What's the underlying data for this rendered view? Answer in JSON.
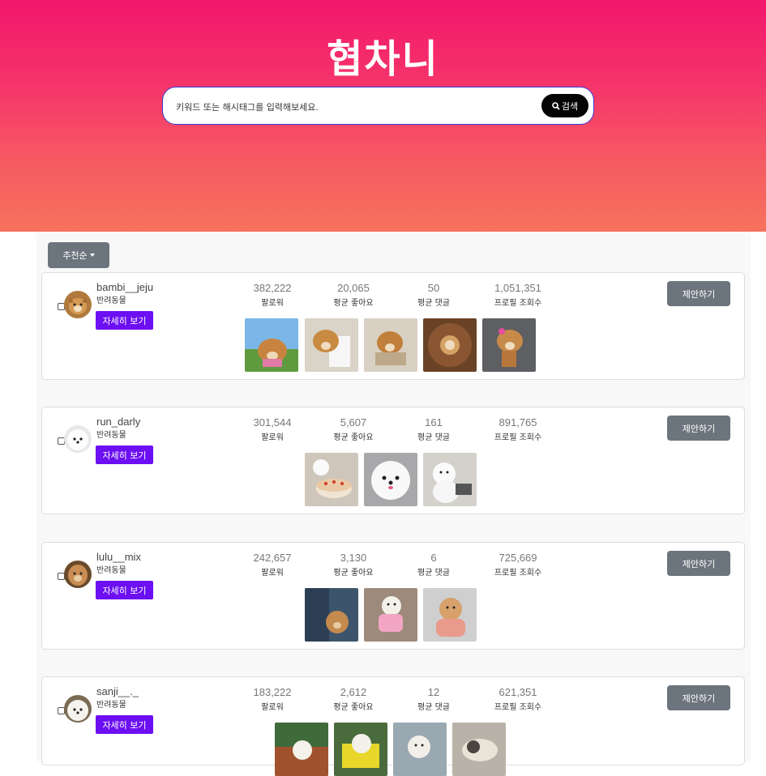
{
  "hero": {
    "title": "협차니"
  },
  "search": {
    "placeholder": "키워드 또는 해시태그를 입력해보세요.",
    "button_label": "검색"
  },
  "sort": {
    "label": "추천순"
  },
  "stat_labels": {
    "followers": "팔로워",
    "avg_likes": "평균 좋아요",
    "avg_comments": "평균 댓글",
    "profile_views": "프로필 조회수"
  },
  "card_labels": {
    "detail": "자세히 보기",
    "propose": "제안하기"
  },
  "influencers": [
    {
      "username": "bambi__jeju",
      "category": "반려동물",
      "followers": "382,222",
      "avg_likes": "20,065",
      "avg_comments": "50",
      "profile_views": "1,051,351",
      "thumb_count": 5
    },
    {
      "username": "run_darly",
      "category": "반려동물",
      "followers": "301,544",
      "avg_likes": "5,607",
      "avg_comments": "161",
      "profile_views": "891,765",
      "thumb_count": 3
    },
    {
      "username": "lulu__mix",
      "category": "반려동물",
      "followers": "242,657",
      "avg_likes": "3,130",
      "avg_comments": "6",
      "profile_views": "725,669",
      "thumb_count": 3
    },
    {
      "username": "sanji__._",
      "category": "반려동물",
      "followers": "183,222",
      "avg_likes": "2,612",
      "avg_comments": "12",
      "profile_views": "621,351",
      "thumb_count": 4
    }
  ],
  "colors": {
    "accent_purple": "#6c0ff2",
    "hero_top": "#f2176c",
    "hero_bottom": "#f7735c",
    "gray_button": "#6c757d"
  }
}
